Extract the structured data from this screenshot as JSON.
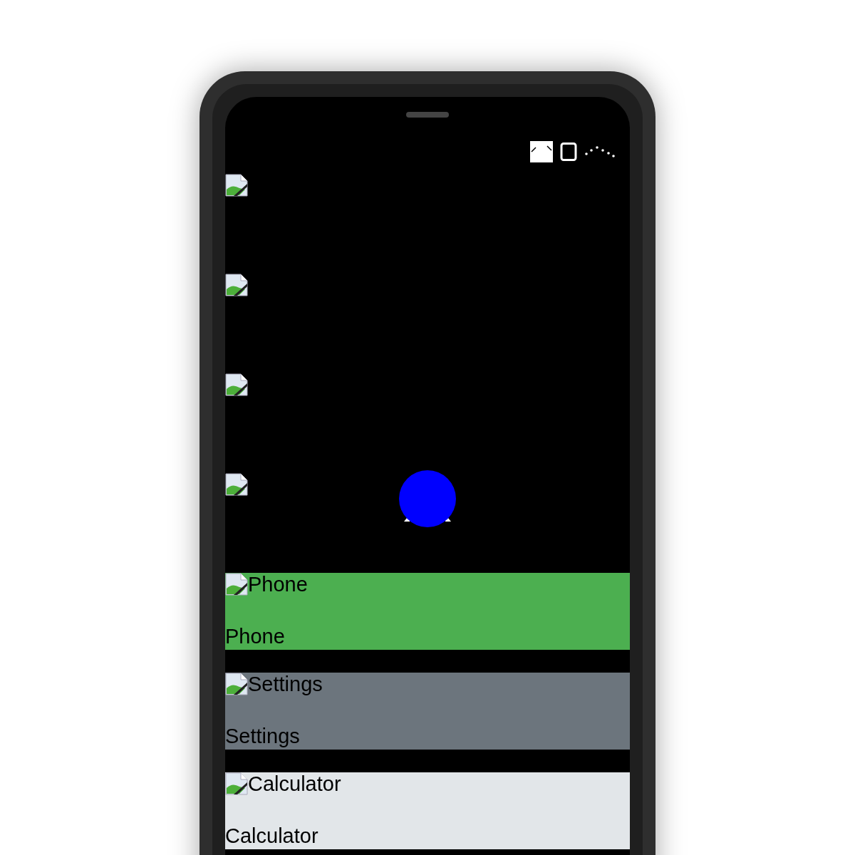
{
  "status_bar": {
    "icons": [
      {
        "kind": "image"
      },
      {
        "kind": "battery"
      },
      {
        "kind": "signal"
      }
    ]
  },
  "home_icons": [
    {
      "kind": "broken-image"
    },
    {
      "kind": "broken-image"
    },
    {
      "kind": "broken-image"
    },
    {
      "kind": "broken-image"
    }
  ],
  "floating_button": {
    "color": "#0000ff"
  },
  "apps": [
    {
      "alt": "Phone",
      "label": "Phone",
      "color": "#4caf50"
    },
    {
      "alt": "Settings",
      "label": "Settings",
      "color": "#6c757d"
    },
    {
      "alt": "Calculator",
      "label": "Calculator",
      "color": "#e2e6e9"
    }
  ]
}
